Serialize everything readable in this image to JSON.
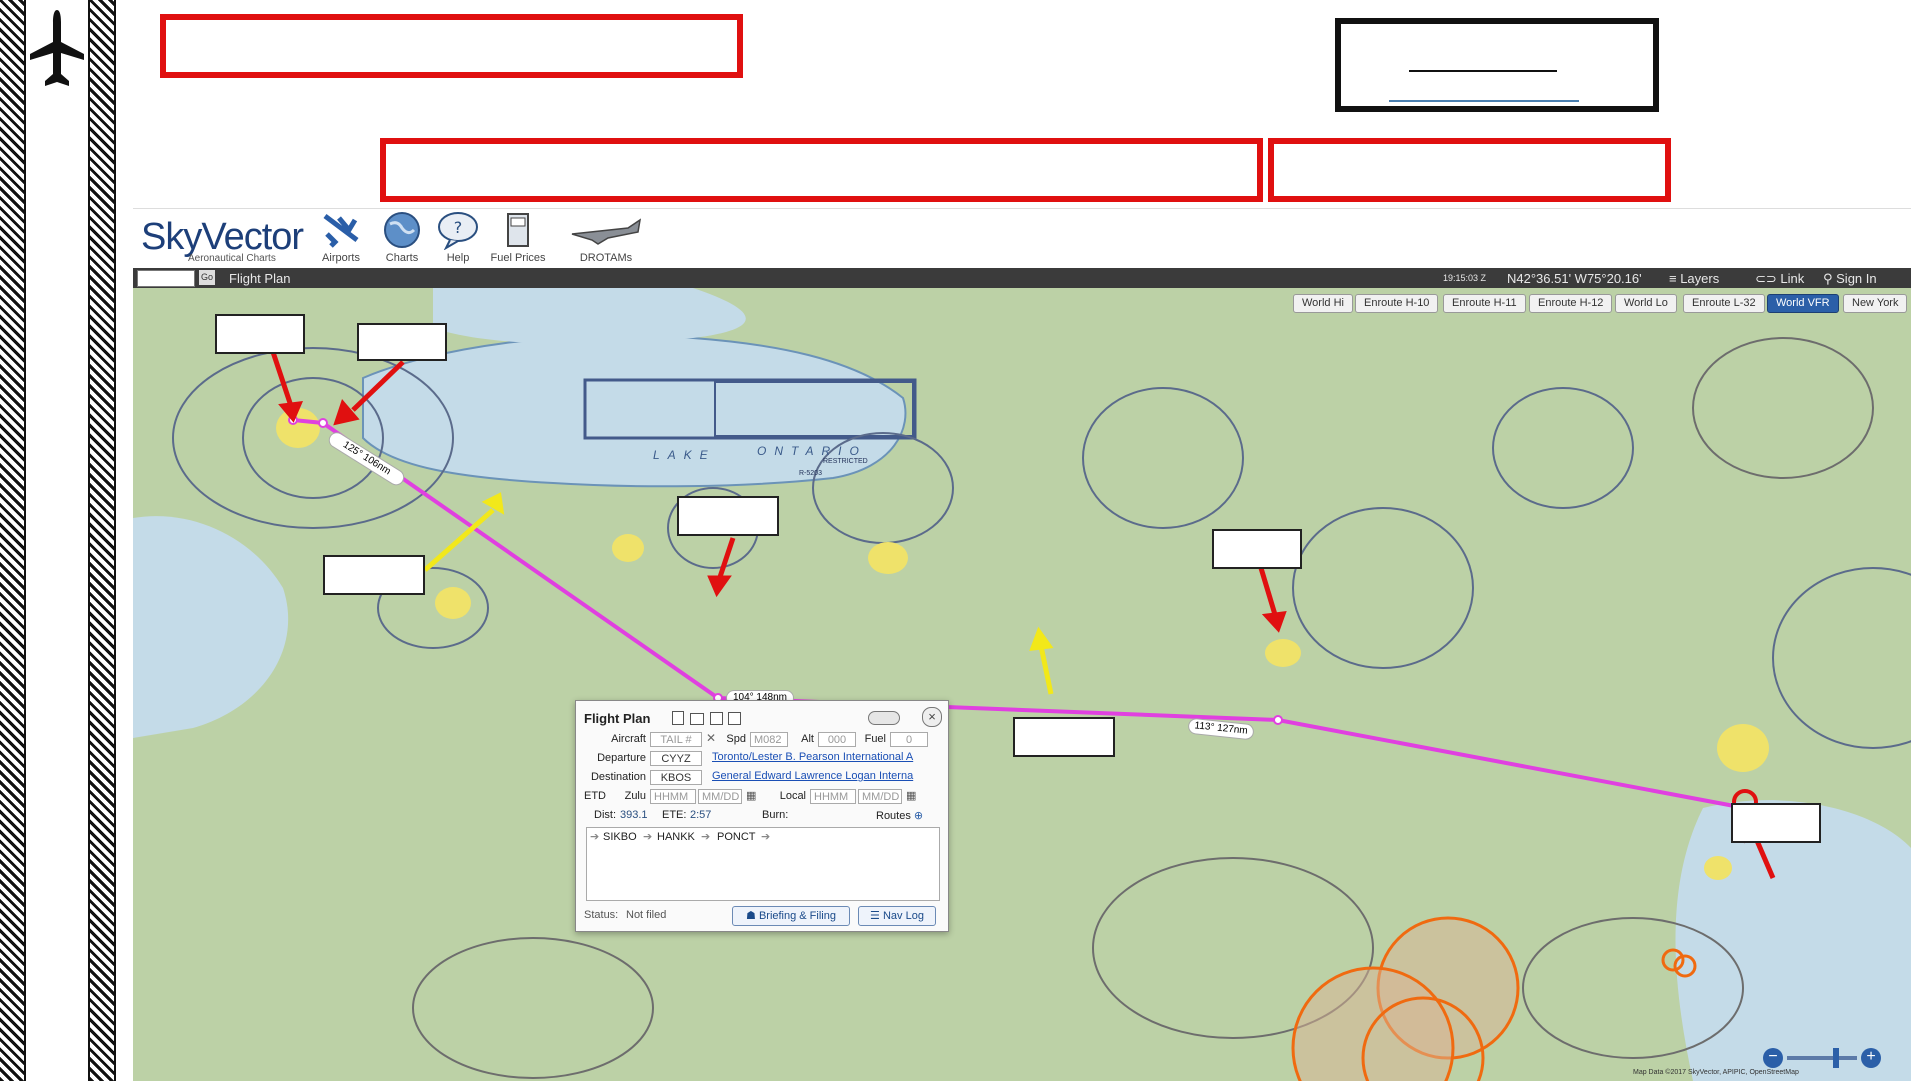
{
  "app": {
    "brand": "SkyVector",
    "brand_sub": "Aeronautical Charts"
  },
  "nav": [
    {
      "label": "Airports",
      "icon": "airplane-icon"
    },
    {
      "label": "Charts",
      "icon": "globe-icon"
    },
    {
      "label": "Help",
      "icon": "help-bubble-icon"
    },
    {
      "label": "Fuel Prices",
      "icon": "fuel-icon"
    },
    {
      "label": "DROTAMs",
      "icon": "drone-icon"
    }
  ],
  "topbar": {
    "go_label": "Go",
    "flight_plan_label": "Flight Plan",
    "time": "19:15:03 Z",
    "coords": "N42°36.51' W75°20.16'",
    "layers": "Layers",
    "link": "Link",
    "sign_in": "Sign In"
  },
  "chart_tabs": [
    {
      "label": "World Hi",
      "active": false
    },
    {
      "label": "Enroute H-10",
      "active": false
    },
    {
      "label": "Enroute H-11",
      "active": false
    },
    {
      "label": "Enroute H-12",
      "active": false
    },
    {
      "label": "World Lo",
      "active": false
    },
    {
      "label": "Enroute L-32",
      "active": false
    },
    {
      "label": "World VFR",
      "active": true
    },
    {
      "label": "New York",
      "active": false
    }
  ],
  "map_labels": {
    "lake": "LAKE",
    "ontario": "ONTARIO",
    "restricted": "RESTRICTED",
    "restricted_id": "R-5203"
  },
  "route_legs": [
    {
      "label": "125° 106nm"
    },
    {
      "label": "104° 148nm"
    },
    {
      "label": "113° 127nm"
    }
  ],
  "flight_plan": {
    "title": "Flight Plan",
    "aircraft_label": "Aircraft",
    "aircraft_placeholder": "TAIL #",
    "spd_label": "Spd",
    "spd_value": "M082",
    "alt_label": "Alt",
    "alt_value": "000",
    "fuel_label": "Fuel",
    "fuel_value": "0",
    "departure_label": "Departure",
    "departure_code": "CYYZ",
    "departure_name": "Toronto/Lester B. Pearson International A",
    "destination_label": "Destination",
    "destination_code": "KBOS",
    "destination_name": "General Edward Lawrence Logan Interna",
    "etd_label": "ETD",
    "zulu_label": "Zulu",
    "zulu_time_ph": "HHMM",
    "zulu_date_ph": "MM/DD",
    "local_label": "Local",
    "local_time_ph": "HHMM",
    "local_date_ph": "MM/DD",
    "dist_label": "Dist:",
    "dist_value": "393.1",
    "ete_label": "ETE:",
    "ete_value": "2:57",
    "burn_label": "Burn:",
    "routes_label": "Routes",
    "waypoints": [
      "SIKBO",
      "HANKK",
      "PONCT"
    ],
    "status_label": "Status:",
    "status_value": "Not filed",
    "briefing_label": "Briefing & Filing",
    "navlog_label": "Nav Log"
  },
  "footer": {
    "map_credit": "Map Data ©2017 SkyVector, APIPIC, OpenStreetMap"
  },
  "colors": {
    "route": "#e040e0",
    "red_annotation": "#e01010",
    "yellow_annotation": "#f2e81a"
  }
}
